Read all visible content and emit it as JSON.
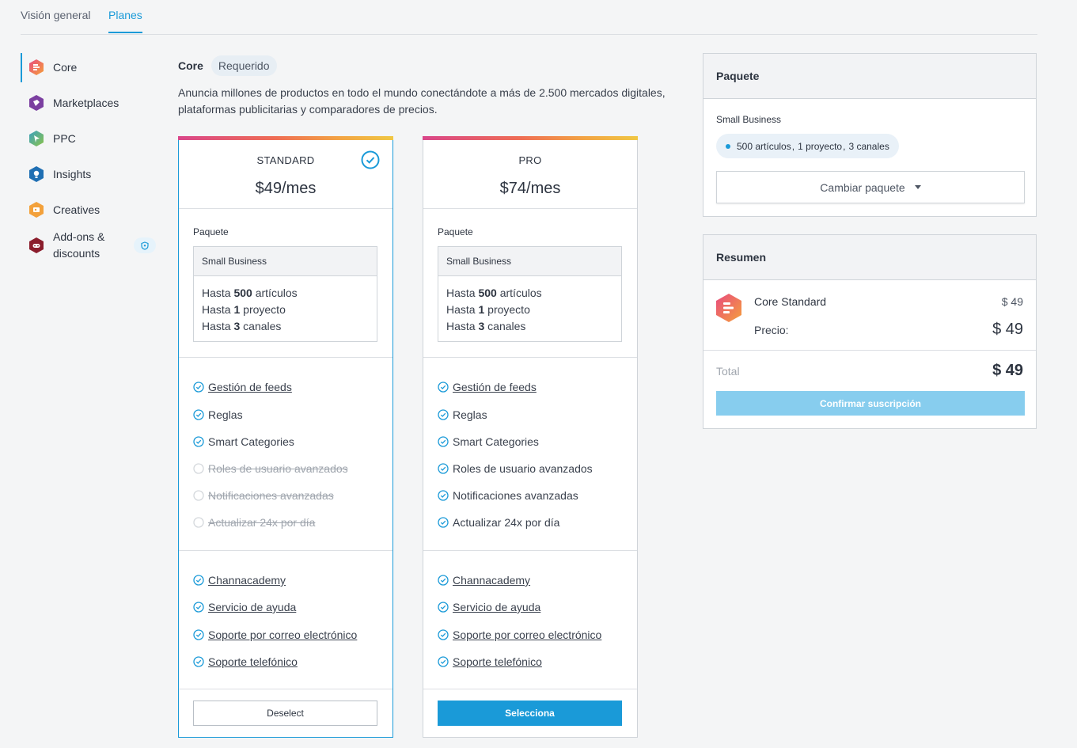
{
  "tabs": [
    {
      "label": "Visión general"
    },
    {
      "label": "Planes"
    }
  ],
  "sidebar": {
    "items": [
      {
        "label": "Core",
        "icon": "core-icon",
        "color": "#ef6d55"
      },
      {
        "label": "Marketplaces",
        "icon": "marketplaces-icon",
        "color": "#7b3fa0"
      },
      {
        "label": "PPC",
        "icon": "ppc-icon",
        "color": "#4aa3a0"
      },
      {
        "label": "Insights",
        "icon": "insights-icon",
        "color": "#1f6fb3"
      },
      {
        "label": "Creatives",
        "icon": "creatives-icon",
        "color": "#f3a13b"
      },
      {
        "label": "Add-ons &",
        "label2": "discounts",
        "icon": "addons-icon",
        "color": "#8b1d2c"
      }
    ]
  },
  "header": {
    "title": "Core",
    "badge": "Requerido",
    "description": "Anuncia millones de productos en todo el mundo conectándote a más de 2.500 mercados digitales, plataformas publicitarias y comparadores de precios."
  },
  "plans": [
    {
      "name": "STANDARD",
      "price": "$49/mes",
      "package_label": "Paquete",
      "package_name": "Small Business",
      "lines": [
        {
          "pre": "Hasta ",
          "num": "500",
          "post": " artículos"
        },
        {
          "pre": "Hasta ",
          "num": "1",
          "post": " proyecto"
        },
        {
          "pre": "Hasta ",
          "num": "3",
          "post": " canales"
        }
      ],
      "features": [
        "Gestión de feeds",
        "Reglas",
        "Smart Categories",
        "Roles de usuario avanzados",
        "Notificaciones avanzadas",
        "Actualizar 24x por día"
      ],
      "support": [
        "Channacademy",
        "Servicio de ayuda",
        "Soporte por correo electrónico",
        "Soporte telefónico"
      ],
      "button": "Deselect"
    },
    {
      "name": "PRO",
      "price": "$74/mes",
      "package_label": "Paquete",
      "package_name": "Small Business",
      "lines": [
        {
          "pre": "Hasta ",
          "num": "500",
          "post": " artículos"
        },
        {
          "pre": "Hasta ",
          "num": "1",
          "post": " proyecto"
        },
        {
          "pre": "Hasta ",
          "num": "3",
          "post": " canales"
        }
      ],
      "features": [
        "Gestión de feeds",
        "Reglas",
        "Smart Categories",
        "Roles de usuario avanzados",
        "Notificaciones avanzadas",
        "Actualizar 24x por día"
      ],
      "support": [
        "Channacademy",
        "Servicio de ayuda",
        "Soporte por correo electrónico",
        "Soporte telefónico"
      ],
      "button": "Selecciona"
    }
  ],
  "package_panel": {
    "title": "Paquete",
    "package_name": "Small Business",
    "chip": [
      "500 artículos",
      "1 proyecto",
      "3 canales"
    ],
    "chip_sep": ",",
    "change_button": "Cambiar paquete"
  },
  "summary_panel": {
    "title": "Resumen",
    "product": "Core Standard",
    "product_price": "$ 49",
    "price_label": "Precio:",
    "price_value": "$ 49",
    "total_label": "Total",
    "total_value": "$ 49",
    "confirm_button": "Confirmar suscripción"
  },
  "colors": {
    "accent": "#1a9ad8",
    "confirm_disabled": "#87cdee"
  }
}
